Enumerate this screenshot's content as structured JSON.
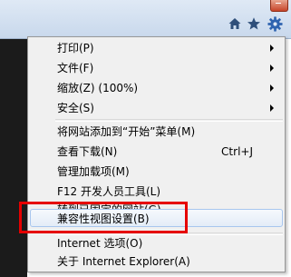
{
  "toolbar": {
    "icons": [
      "home-icon",
      "star-icon",
      "gear-icon"
    ]
  },
  "menu": {
    "items": [
      {
        "label": "打印(P)",
        "submenu": true
      },
      {
        "label": "文件(F)",
        "submenu": true
      },
      {
        "label": "缩放(Z) (100%)",
        "submenu": true
      },
      {
        "label": "安全(S)",
        "submenu": true
      },
      {
        "label": "将网站添加到“开始”菜单(M)"
      },
      {
        "label": "查看下载(N)",
        "shortcut": "Ctrl+J"
      },
      {
        "label": "管理加载项(M)"
      },
      {
        "label": "F12 开发人员工具(L)"
      },
      {
        "label": "转到已固定的网站(G)"
      },
      {
        "label": "兼容性视图设置(B)",
        "highlighted": true
      },
      {
        "label": "Internet 选项(O)"
      },
      {
        "label": "关于 Internet Explorer(A)"
      }
    ]
  },
  "colors": {
    "annotation_red": "#e60000",
    "menu_bg": "#f0f0f0",
    "toolbar_bg": "#c8d8ec"
  }
}
